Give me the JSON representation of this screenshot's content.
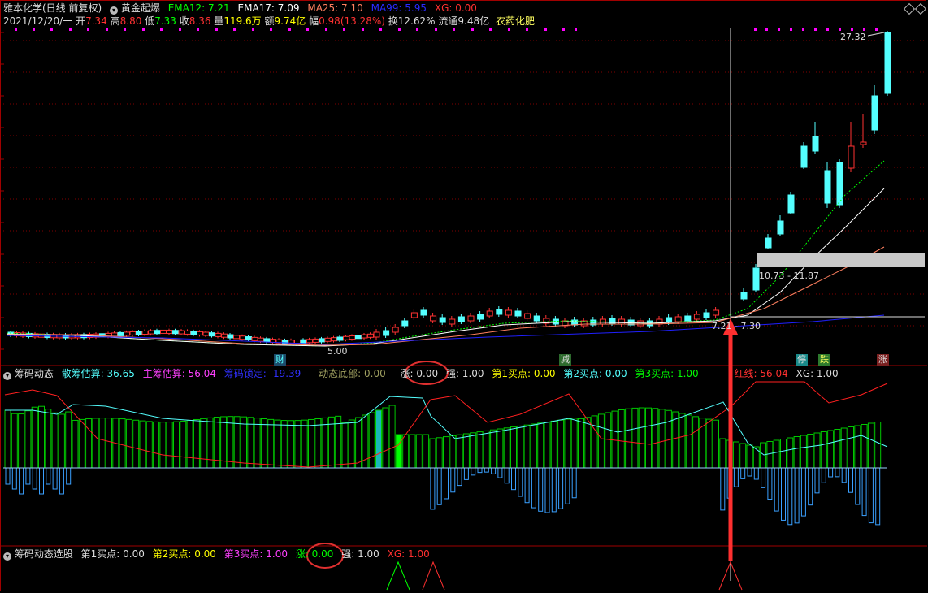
{
  "header": {
    "stock_name": "雅本化学(日线 前复权)",
    "indicator_name": "黄金起爆",
    "ema12": "EMA12: 7.21",
    "ema17": "EMA17: 7.09",
    "ma25": "MA25: 7.10",
    "ma99": "MA99: 5.95",
    "xg": "XG: 0.00"
  },
  "info_row": {
    "date": "2021/12/20/一",
    "open_label": "开",
    "open": "7.34",
    "high_label": "高",
    "high": "8.80",
    "low_label": "低",
    "low": "7.33",
    "close_label": "收",
    "close": "8.36",
    "volume_label": "量",
    "volume": "119.6万",
    "amount_label": "额",
    "amount": "9.74亿",
    "range_label": "幅",
    "range": "0.98(13.28%)",
    "turnover_label": "换",
    "turnover": "12.62%",
    "float_label": "流通",
    "float": "9.48亿",
    "sector": "农药化肥"
  },
  "price_labels": {
    "max": "27.32",
    "min": "5.00",
    "band": "10.73 - 11.87",
    "cross": "7.21 - 7.30"
  },
  "markers": {
    "cai": "财",
    "jian": "减",
    "ting": "停",
    "die": "跌",
    "zhang": "涨"
  },
  "panel2": {
    "name": "筹码动态",
    "sancou": "散筹估算: 36.65",
    "zhucou": "主筹估算: 56.04",
    "suoding": "筹码锁定: -19.39",
    "dibu": "动态底部: 0.00",
    "zhang": "涨: 0.00",
    "qiang": "强: 1.00",
    "mai1": "第1买点: 0.00",
    "mai2": "第2买点: 0.00",
    "mai3": "第3买点: 1.00",
    "hongxian": "红线: 56.04",
    "xg": "XG: 1.00"
  },
  "panel3": {
    "name": "筹码动态选股",
    "mai1": "第1买点: 0.00",
    "mai2": "第2买点: 0.00",
    "mai3": "第3买点: 1.00",
    "zhang": "涨: 0.00",
    "qiang": "强: 1.00",
    "xg": "XG: 1.00"
  },
  "colors": {
    "up": "#ff3232",
    "down": "#54ffff",
    "ema12": "#00ff00",
    "ema17": "#ffffff",
    "ma25": "#ff8060",
    "ma99": "#2020ff",
    "grid": "#800000",
    "red_line": "#ff2020",
    "bar_edge": "#00c800",
    "neg_bar": "#3aa0ff"
  }
}
